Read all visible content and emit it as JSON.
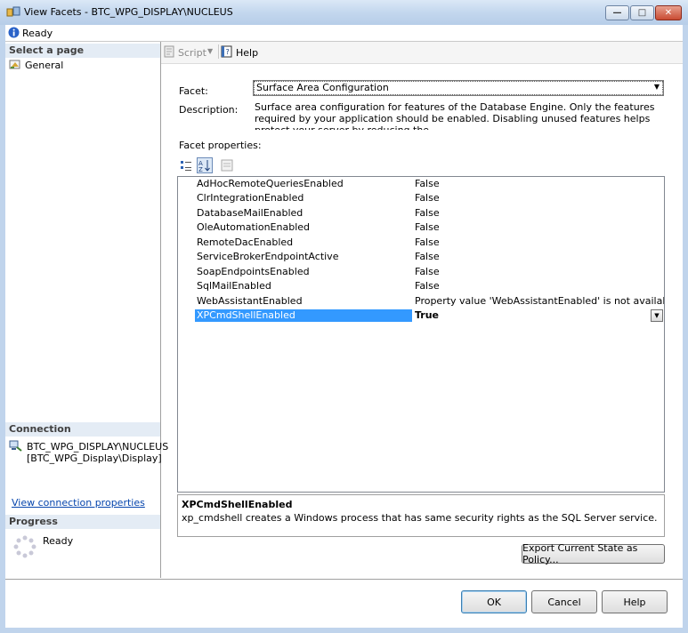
{
  "window": {
    "title": "View Facets - BTC_WPG_DISPLAY\\NUCLEUS",
    "minimize_label": "—",
    "maximize_label": "□",
    "close_label": "✕"
  },
  "status": {
    "text": "Ready"
  },
  "left_pane": {
    "select_page_header": "Select a page",
    "pages": [
      {
        "label": "General"
      }
    ],
    "connection_header": "Connection",
    "connection_server": "BTC_WPG_DISPLAY\\NUCLEUS",
    "connection_user": "[BTC_WPG_Display\\Display]",
    "view_connection_link": "View connection properties",
    "progress_header": "Progress",
    "progress_status": "Ready"
  },
  "toolbar": {
    "script_label": "Script",
    "help_label": "Help"
  },
  "form": {
    "facet_label": "Facet:",
    "facet_value": "Surface Area Configuration",
    "description_label": "Description:",
    "description_text": "Surface area configuration for features of the Database Engine. Only the features required by your application should be enabled. Disabling unused features helps protect your server by reducing the",
    "facet_properties_label": "Facet properties:"
  },
  "properties": [
    {
      "name": "AdHocRemoteQueriesEnabled",
      "value": "False"
    },
    {
      "name": "ClrIntegrationEnabled",
      "value": "False"
    },
    {
      "name": "DatabaseMailEnabled",
      "value": "False"
    },
    {
      "name": "OleAutomationEnabled",
      "value": "False"
    },
    {
      "name": "RemoteDacEnabled",
      "value": "False"
    },
    {
      "name": "ServiceBrokerEndpointActive",
      "value": "False"
    },
    {
      "name": "SoapEndpointsEnabled",
      "value": "False"
    },
    {
      "name": "SqlMailEnabled",
      "value": "False"
    },
    {
      "name": "WebAssistantEnabled",
      "value": "Property value 'WebAssistantEnabled' is not available."
    },
    {
      "name": "XPCmdShellEnabled",
      "value": "True"
    }
  ],
  "help_panel": {
    "title": "XPCmdShellEnabled",
    "text": "xp_cmdshell creates a Windows process that has same security rights as the SQL Server service."
  },
  "buttons": {
    "export": "Export Current State as Policy...",
    "ok": "OK",
    "cancel": "Cancel",
    "help": "Help"
  }
}
